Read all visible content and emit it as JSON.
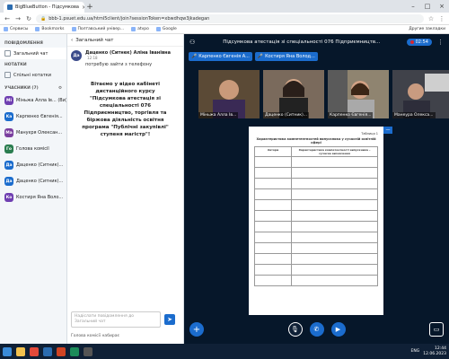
{
  "browser": {
    "tabs": [
      {
        "title": "BigBlueButton - Підсумкова"
      },
      {
        "title": ""
      }
    ],
    "url": "bbb-1.psuet.edu.ua/html5client/join?sessionToken=xbwdhqw3jkadegan",
    "bookmarks": [
      "Сервисы",
      "Bookmarks",
      "Полтавський універ...",
      "atvpo",
      "Google"
    ],
    "bookmarks_right": "Другие закладки"
  },
  "left": {
    "messages_title": "ПОВІДОМЛЕННЯ",
    "public_chat": "Загальний чат",
    "notes_title": "НОТАТКИ",
    "shared_notes": "Спільні нотатки",
    "users_title": "УЧАСНИКИ (7)",
    "users": [
      {
        "initials": "Mi",
        "name": "Міньжа Алла Ів... (Ви)",
        "color": "#6f3fb1"
      },
      {
        "initials": "Ka",
        "name": "Карпенко Євгенія...",
        "color": "#1b6ccd"
      },
      {
        "initials": "Ma",
        "name": "Мануєря Олексан...",
        "color": "#7a3e9e"
      },
      {
        "initials": "Го",
        "name": "Голова комісії",
        "color": "#2a7d4f"
      },
      {
        "initials": "Да",
        "name": "Даценко (Ситник)...",
        "color": "#1b6ccd"
      },
      {
        "initials": "Да",
        "name": "Даценко (Ситник)...",
        "color": "#1b6ccd"
      },
      {
        "initials": "Ко",
        "name": "Костиря Яна Воло...",
        "color": "#6f3fb1"
      }
    ]
  },
  "chat": {
    "title": "Загальний чат",
    "sender": "Даценко (Ситнек) Аліна Іванівна",
    "time": "12:18",
    "message": "потребую зайти з телефону",
    "welcome": "Вітаємо у відео кабінеті дистанційного курсу \"Підсумкова атестація зі спеціальності 076 Підприємництво, торгівля та біржова діяльність освітня програма \"Публічні закупівлі\" ступеня магістр\"!",
    "input_placeholder": "Надіслати повідомлення до Загальний чат",
    "footer": "Голова комісії набирає"
  },
  "meeting": {
    "title": "Підсумкова атестація зі спеціальності 076 Підприємництв...",
    "recording_time": "02:54",
    "speakers": [
      "Карпенко Євгенія А...",
      "Костиря Яна Волод..."
    ],
    "videos": [
      "Міньжа Алла Ів...",
      "Даценко (Ситник)...",
      "Карпенко Євгенія...",
      "Манеура Олекса..."
    ]
  },
  "document": {
    "label": "Таблиця 1",
    "title": "Характеристика компетентностей випускника у сучасній освітній сфері",
    "col1": "Автори",
    "col2": "Характеристика компетентності випускника – сучасне визначення"
  },
  "taskbar": {
    "lang": "ENG",
    "time": "12:44",
    "date": "12.06.2023"
  },
  "colors": {
    "accent": "#1b6ccd",
    "stage": "#06172a"
  }
}
